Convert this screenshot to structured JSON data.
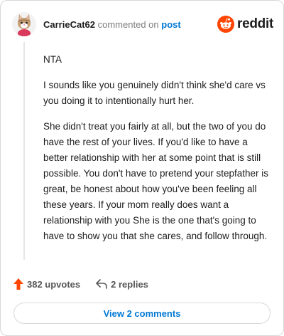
{
  "header": {
    "username": "CarrieCat62",
    "action_text": "commented on",
    "post_link": "post",
    "brand_name": "reddit",
    "avatar_icon": "snoo-cat-avatar-icon",
    "brand_icon": "reddit-snoo-icon"
  },
  "comment": {
    "paragraphs": [
      "NTA",
      "I sounds like you genuinely didn't think she'd care vs you doing it to intentionally hurt her.",
      "She didn't treat you fairly at all, but the two of you do have the rest of your lives. If you'd like to have a better relationship with her at some point that is still possible. You don't have to pretend your stepfather is great, be honest about how you've been feeling all these years. If your mom really does want a relationship with you She is the one that's going to have to show you that she cares, and follow through."
    ]
  },
  "actions": {
    "upvotes": "382 upvotes",
    "replies": "2 replies",
    "upvote_icon": "upvote-arrow-icon",
    "reply_icon": "reply-arrow-icon"
  },
  "view_comments_label": "View 2 comments",
  "colors": {
    "brand_orange": "#ff4500",
    "link_blue": "#0079d3",
    "muted_text": "#7c7c7c",
    "border": "#d8d8d8"
  }
}
